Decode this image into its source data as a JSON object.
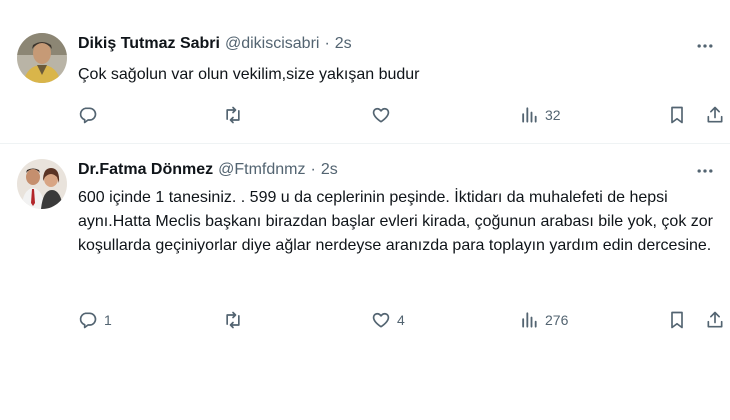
{
  "tweets": [
    {
      "name": "Dikiş Tutmaz Sabri",
      "handle": "@dikiscisabri",
      "separator": "·",
      "time": "2s",
      "text": "Çok sağolun var olun vekilim,size yakışan budur",
      "counts": {
        "reply": "",
        "retweet": "",
        "like": "",
        "views": "32"
      }
    },
    {
      "name": "Dr.Fatma Dönmez",
      "handle": "@Ftmfdnmz",
      "separator": "·",
      "time": "2s",
      "text": "600 içinde 1 tanesiniz. . 599 u da  ceplerinin peşinde. İktidarı da muhalefeti de hepsi aynı.Hatta Meclis başkanı birazdan başlar evleri kirada, çoğunun arabası bile yok, çok zor koşullarda geçiniyorlar diye ağlar nerdeyse aranızda para toplayın yardım edin dercesine.",
      "counts": {
        "reply": "1",
        "retweet": "",
        "like": "4",
        "views": "276"
      }
    }
  ],
  "icons": {
    "reply": "reply-icon",
    "retweet": "retweet-icon",
    "like": "heart-icon",
    "views": "views-icon",
    "bookmark": "bookmark-icon",
    "share": "share-icon",
    "more": "more-icon"
  },
  "colors": {
    "text": "#0f1419",
    "secondary": "#536471",
    "divider": "#eff3f4"
  }
}
